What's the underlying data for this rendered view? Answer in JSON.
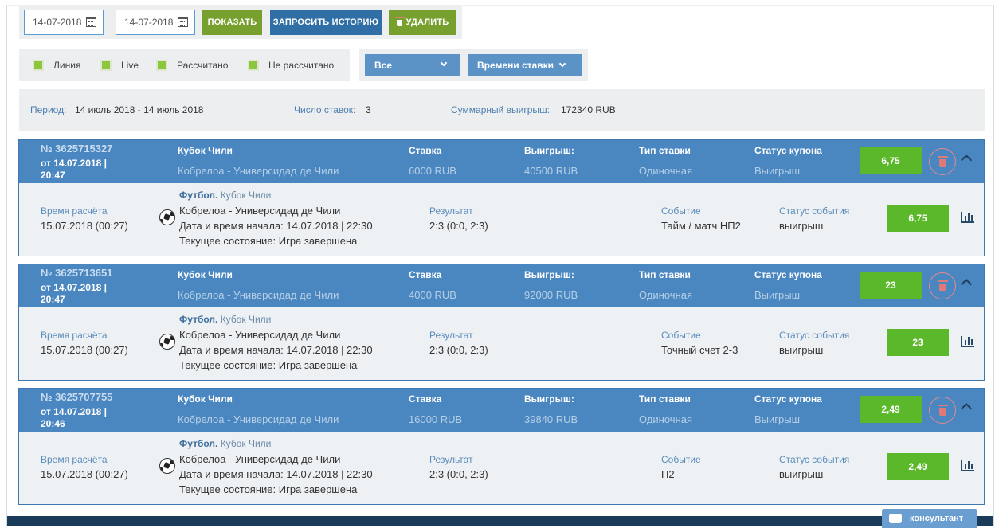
{
  "toolbar": {
    "date_from": "14-07-2018",
    "date_to": "14-07-2018",
    "separator": "–",
    "show_label": "ПОКАЗАТЬ",
    "history_label": "ЗАПРОСИТЬ ИСТОРИЮ",
    "delete_label": "УДАЛИТЬ"
  },
  "filters": {
    "checkboxes": [
      "Линия",
      "Live",
      "Рассчитано",
      "Не рассчитано"
    ],
    "select_all": "Все",
    "select_sort": "Времени ставки"
  },
  "summary": {
    "period_label": "Период:",
    "period_value": "14 июль 2018 - 14 июль 2018",
    "count_label": "Число ставок:",
    "count_value": "3",
    "total_label": "Суммарный выигрыш:",
    "total_value": "172340 RUB"
  },
  "labels": {
    "tournament": "Кубок Чили",
    "stake": "Ставка",
    "win": "Выигрыш:",
    "bet_type": "Тип ставки",
    "coupon_status": "Статус купона",
    "calc_time": "Время расчёта",
    "sport": "Футбол.",
    "result": "Результат",
    "event": "Событие",
    "event_status": "Статус события"
  },
  "coupons": [
    {
      "number": "№ 3625715327",
      "date": "от 14.07.2018 | 20:47",
      "match": "Кобрелоа - Универсидад де Чили",
      "stake": "6000 RUB",
      "win": "40500 RUB",
      "bet_type": "Одиночная",
      "coupon_status": "Выигрыш",
      "odds": "6,75",
      "calc_time": "15.07.2018 (00:27)",
      "tournament": "Кубок Чили",
      "start": "Дата и время начала: 14.07.2018 | 22:30",
      "state": "Текущее состояние: Игра завершена",
      "result": "2:3 (0:0, 2:3)",
      "event": "Тайм / матч НП2",
      "event_status": "выигрыш"
    },
    {
      "number": "№ 3625713651",
      "date": "от 14.07.2018 | 20:47",
      "match": "Кобрелоа - Универсидад де Чили",
      "stake": "4000 RUB",
      "win": "92000 RUB",
      "bet_type": "Одиночная",
      "coupon_status": "Выигрыш",
      "odds": "23",
      "calc_time": "15.07.2018 (00:27)",
      "tournament": "Кубок Чили",
      "start": "Дата и время начала: 14.07.2018 | 22:30",
      "state": "Текущее состояние: Игра завершена",
      "result": "2:3 (0:0, 2:3)",
      "event": "Точный счет 2-3",
      "event_status": "выигрыш"
    },
    {
      "number": "№ 3625707755",
      "date": "от 14.07.2018 | 20:46",
      "match": "Кобрелоа - Универсидад де Чили",
      "stake": "16000 RUB",
      "win": "39840 RUB",
      "bet_type": "Одиночная",
      "coupon_status": "Выигрыш",
      "odds": "2,49",
      "calc_time": "15.07.2018 (00:27)",
      "tournament": "Кубок Чили",
      "start": "Дата и время начала: 14.07.2018 | 22:30",
      "state": "Текущее состояние: Игра завершена",
      "result": "2:3 (0:0, 2:3)",
      "event": "П2",
      "event_status": "выигрыш"
    }
  ],
  "consultant_label": "консультант"
}
